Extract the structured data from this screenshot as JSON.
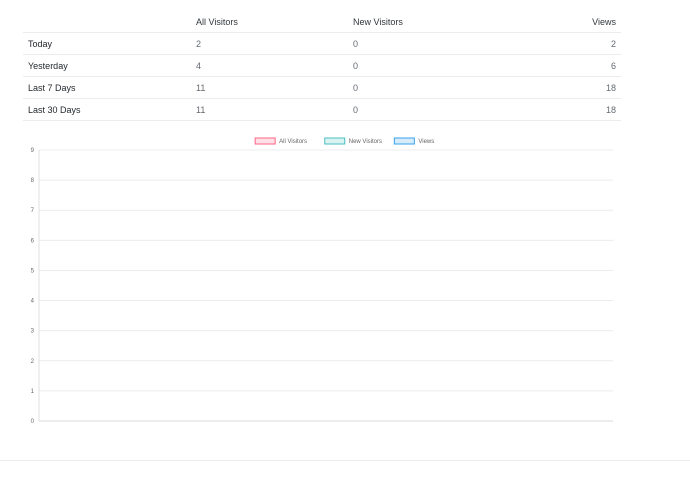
{
  "table": {
    "headers": {
      "all_visitors": "All Visitors",
      "new_visitors": "New Visitors",
      "views": "Views"
    },
    "rows": [
      {
        "label": "Today",
        "all_visitors": "2",
        "new_visitors": "0",
        "views": "2"
      },
      {
        "label": "Yesterday",
        "all_visitors": "4",
        "new_visitors": "0",
        "views": "6"
      },
      {
        "label": "Last 7 Days",
        "all_visitors": "11",
        "new_visitors": "0",
        "views": "18"
      },
      {
        "label": "Last 30 Days",
        "all_visitors": "11",
        "new_visitors": "0",
        "views": "18"
      }
    ]
  },
  "chart_data": {
    "type": "line",
    "title": "",
    "xlabel": "",
    "ylabel": "",
    "ylim": [
      0,
      9
    ],
    "yticks": [
      0,
      1,
      2,
      3,
      4,
      5,
      6,
      7,
      8,
      9
    ],
    "grid": true,
    "legend_position": "top-center",
    "categories": [],
    "series": [
      {
        "name": "All Visitors",
        "color": "#ff6384",
        "fill": "#ffe0e6",
        "values": []
      },
      {
        "name": "New Visitors",
        "color": "#4bc0c0",
        "fill": "#dbf2f2",
        "values": []
      },
      {
        "name": "Views",
        "color": "#36a2eb",
        "fill": "#d7ecfb",
        "values": []
      }
    ]
  }
}
